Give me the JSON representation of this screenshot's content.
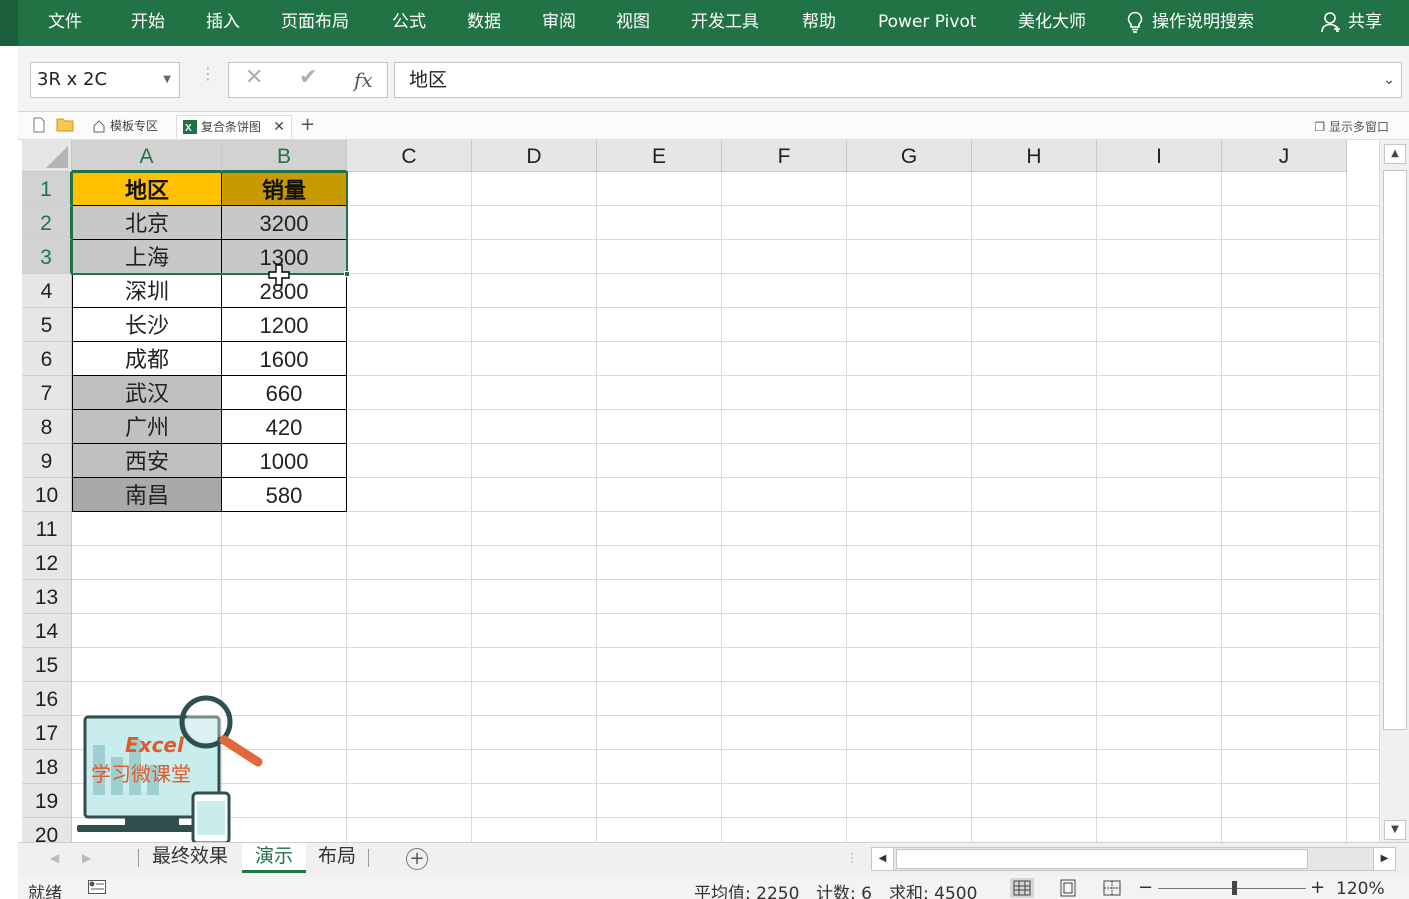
{
  "ribbon": {
    "tabs": [
      "文件",
      "开始",
      "插入",
      "页面布局",
      "公式",
      "数据",
      "审阅",
      "视图",
      "开发工具",
      "帮助",
      "Power Pivot",
      "美化大师"
    ],
    "tell_me": "操作说明搜索",
    "share": "共享",
    "color": "#217346"
  },
  "formula_bar": {
    "name_box": "3R x 2C",
    "fx_label": "fx",
    "content": "地区"
  },
  "doc_tabs": {
    "tabs": [
      {
        "label": "模板专区",
        "icon": "home-icon"
      },
      {
        "label": "复合条饼图",
        "icon": "excel-file-icon",
        "active": true
      }
    ],
    "multi_window": "显示多窗口"
  },
  "grid": {
    "columns": [
      "A",
      "B",
      "C",
      "D",
      "E",
      "F",
      "G",
      "H",
      "I",
      "J"
    ],
    "rows": [
      "1",
      "2",
      "3",
      "4",
      "5",
      "6",
      "7",
      "8",
      "9",
      "10",
      "11",
      "12",
      "13",
      "14",
      "15",
      "16",
      "17",
      "18",
      "19",
      "20"
    ],
    "header_colors": {
      "region": "#ffc000",
      "sales": "#c99a00"
    },
    "table": [
      {
        "region": "地区",
        "sales": "销量",
        "header": true
      },
      {
        "region": "北京",
        "sales": "3200",
        "fill": "#c8c8c8"
      },
      {
        "region": "上海",
        "sales": "1300",
        "fill": "#c8c8c8"
      },
      {
        "region": "深圳",
        "sales": "2800",
        "fill": "#ffffff"
      },
      {
        "region": "长沙",
        "sales": "1200",
        "fill": "#ffffff"
      },
      {
        "region": "成都",
        "sales": "1600",
        "fill": "#ffffff"
      },
      {
        "region": "武汉",
        "sales": "660",
        "fill": "#c0c0c0"
      },
      {
        "region": "广州",
        "sales": "420",
        "fill": "#c0c0c0"
      },
      {
        "region": "西安",
        "sales": "1000",
        "fill": "#c0c0c0"
      },
      {
        "region": "南昌",
        "sales": "580",
        "fill": "#a9a9a9"
      }
    ]
  },
  "logo": {
    "title": "Excel",
    "subtitle": "学习微课堂"
  },
  "sheet_tabs": {
    "tabs": [
      "最终效果",
      "演示",
      "布局"
    ],
    "active_index": 1
  },
  "status_bar": {
    "ready": "就绪",
    "average": "平均值: 2250",
    "count": "计数: 6",
    "sum": "求和: 4500",
    "zoom": "120%"
  }
}
